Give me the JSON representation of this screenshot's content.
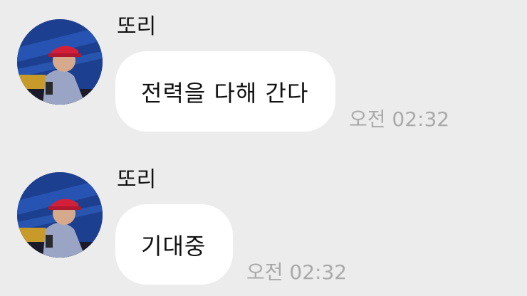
{
  "messages": [
    {
      "sender": "또리",
      "text": "전력을 다해 간다",
      "time": "오전 02:32",
      "avatar_icon": "profile-photo"
    },
    {
      "sender": "또리",
      "text": "기대중",
      "time": "오전 02:32",
      "avatar_icon": "profile-photo"
    }
  ],
  "colors": {
    "background": "#ececec",
    "bubble": "#ffffff",
    "time": "#a9a9a9",
    "avatar_bg": "#1d3f8f",
    "cap": "#d3203a",
    "hoodie": "#9aa4c4"
  }
}
